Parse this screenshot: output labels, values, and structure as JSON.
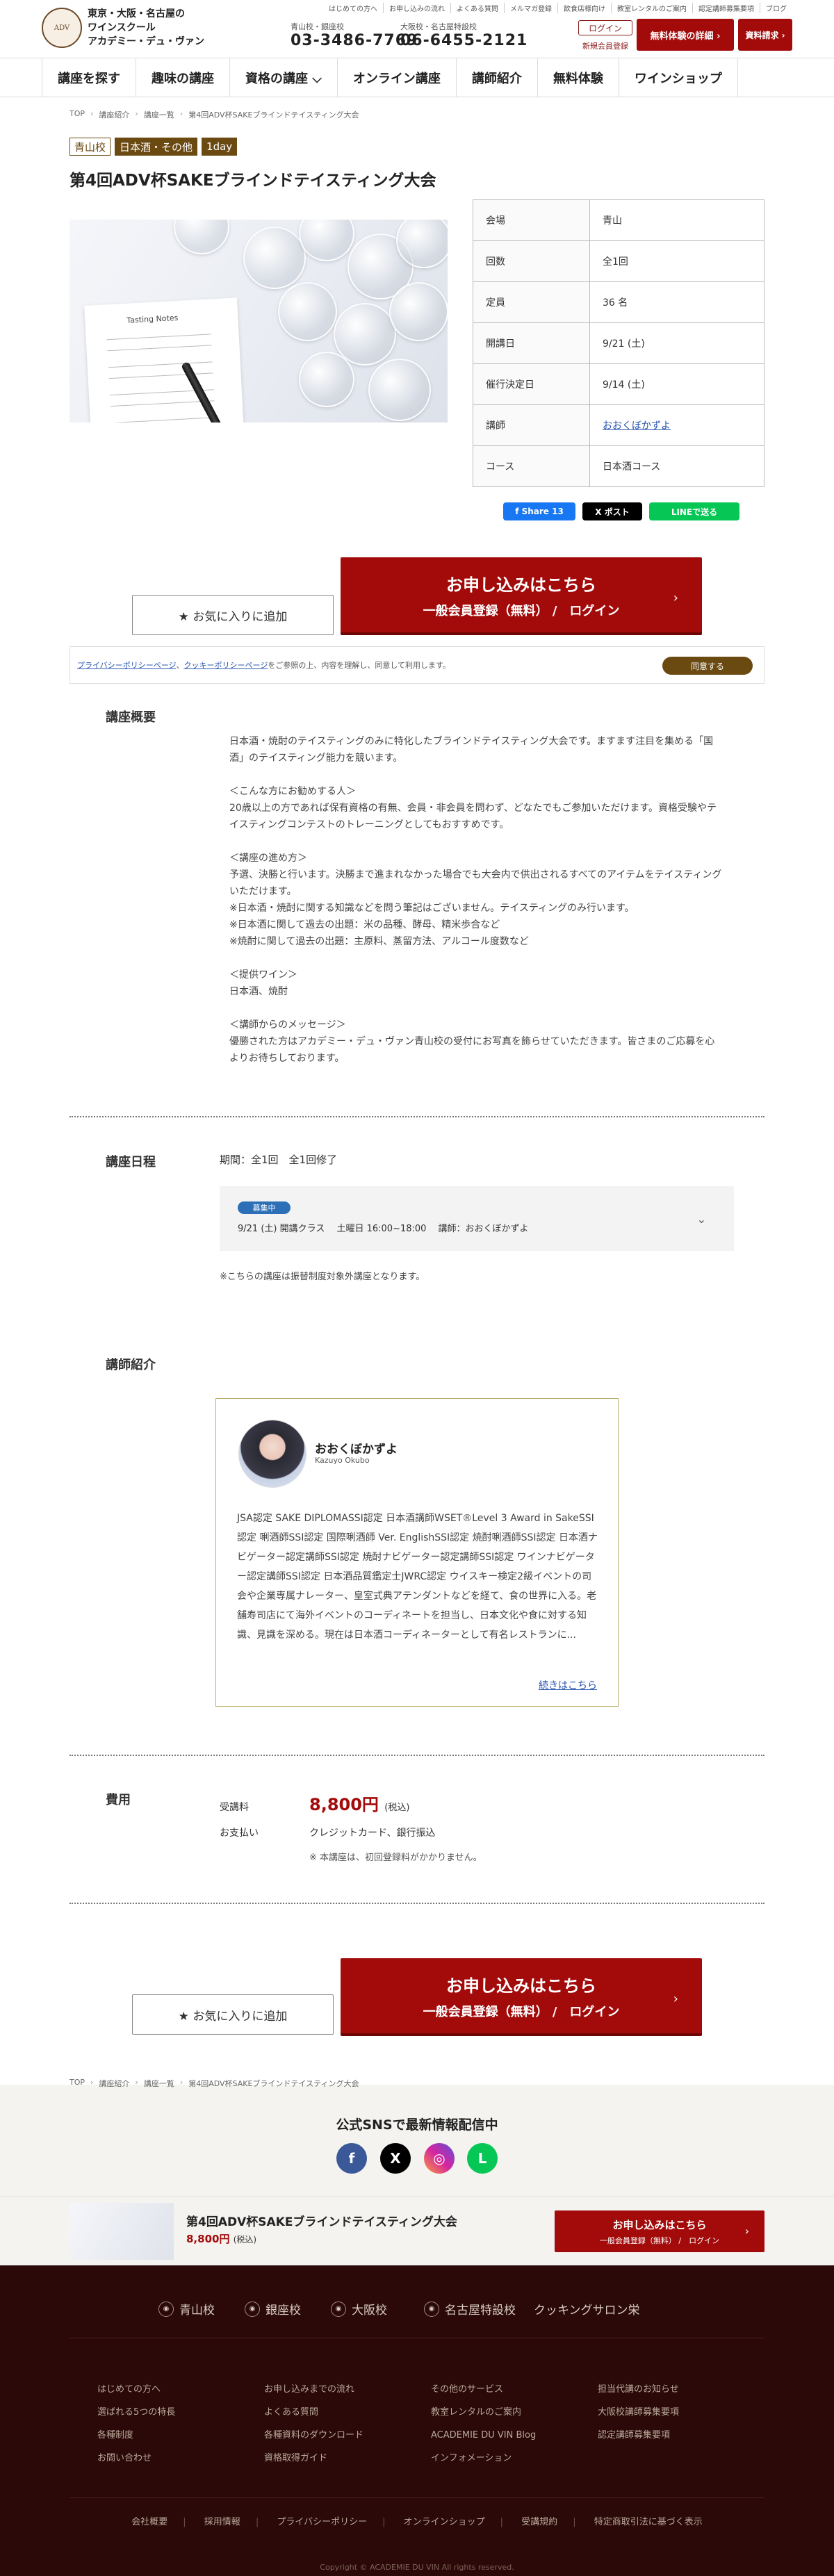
{
  "header": {
    "logo_mark": "ADV",
    "logo_lines": [
      "東京・大阪・名古屋の",
      "ワインスクール",
      "アカデミー・デュ・ヴァン"
    ],
    "util_links": [
      "はじめての方へ",
      "お申し込みの流れ",
      "よくある質問",
      "メルマガ登録",
      "飲食店様向け",
      "教室レンタルのご案内",
      "認定講師募集要項",
      "ブログ"
    ],
    "phone1_label": "青山校・銀座校",
    "phone1_num": "03-3486-7769",
    "phone2_label": "大阪校・名古屋特設校",
    "phone2_num": "06-6455-2121",
    "login": "ログイン",
    "register": "新規会員登録",
    "trial": "無料体験の詳細 ›",
    "docs": "資料請求 ›"
  },
  "nav": [
    "講座を探す",
    "趣味の講座",
    "資格の講座 ⌵",
    "オンライン講座",
    "講師紹介",
    "無料体験",
    "ワインショップ"
  ],
  "breadcrumb": [
    "TOP",
    "講座紹介",
    "講座一覧",
    "第4回ADV杯SAKEブラインドテイスティング大会"
  ],
  "tags": [
    "青山校",
    "日本酒・その他",
    "1day"
  ],
  "title": "第4回ADV杯SAKEブラインドテイスティング大会",
  "photo_text": "Tasting Notes",
  "info": [
    {
      "k": "会場",
      "v": "青山"
    },
    {
      "k": "回数",
      "v": "全1回"
    },
    {
      "k": "定員",
      "v": "36 名"
    },
    {
      "k": "開講日",
      "v": "9/21 (土)"
    },
    {
      "k": "催行決定日",
      "v": "9/14 (土)"
    },
    {
      "k": "講師",
      "v": "おおくぼかずよ"
    },
    {
      "k": "コース",
      "v": "日本酒コース"
    }
  ],
  "share": {
    "fb": "f Share 13",
    "x": "X ポスト",
    "line": "LINEで送る"
  },
  "fav_label": "★ お気に入りに追加",
  "apply": {
    "line1": "お申し込みはこちら",
    "line2": "一般会員登録（無料） /　ログイン",
    "arrow": "›"
  },
  "cookie": {
    "privacy": "プライバシーポリシーページ",
    "sep": "、",
    "cookie_policy": "クッキーポリシーページ",
    "rest": "をご参照の上、内容を理解し、同意して利用します。",
    "button": "同意する"
  },
  "overview": {
    "heading": "講座概要",
    "paragraphs": [
      "日本酒・焼酎のテイスティングのみに特化したブラインドテイスティング大会です。ますます注目を集める「国酒」のテイスティング能力を競います。",
      "＜こんな方にお勧めする人＞",
      "20歳以上の方であれば保有資格の有無、会員・非会員を問わず、どなたでもご参加いただけます。資格受験やテイスティングコンテストのトレーニングとしてもおすすめです。",
      "＜講座の進め方＞",
      "予選、決勝と行います。決勝まで進まれなかった場合でも大会内で供出されるすべてのアイテムをテイスティングいただけます。",
      "※日本酒・焼酎に関する知識などを問う筆記はございません。テイスティングのみ行います。",
      "※日本酒に関して過去の出題：米の品種、酵母、精米歩合など",
      "※焼酎に関して過去の出題：主原料、蒸留方法、アルコール度数など",
      "＜提供ワイン＞",
      "日本酒、焼酎",
      "＜講師からのメッセージ＞",
      "優勝された方はアカデミー・デュ・ヴァン青山校の受付にお写真を飾らせていただきます。皆さまのご応募を心よりお待ちしております。"
    ]
  },
  "schedule": {
    "heading": "講座日程",
    "meta": "期間：全1回　全1回修了",
    "badge": "募集中",
    "line": "9/21 (土) 開講クラス　 土曜日 16:00~18:00　 講師：おおくぼかずよ",
    "chevron": "⌄",
    "note": "※こちらの講座は振替制度対象外講座となります。"
  },
  "teacher": {
    "heading": "講師紹介",
    "name": "おおくぼかずよ",
    "name_en": "Kazuyo Okubo",
    "bio": "JSA認定 SAKE DIPLOMASSI認定 日本酒講師WSET®Level 3 Award in SakeSSI認定 唎酒師SSI認定 国際唎酒師 Ver. EnglishSSI認定 焼酎唎酒師SSI認定 日本酒ナビゲーター認定講師SSI認定 焼酎ナビゲーター認定講師SSI認定 ワインナビゲーター認定講師SSI認定 日本酒品質鑑定士JWRC認定 ウイスキー検定2級イベントの司会や企業専属ナレーター、皇室式典アテンダントなどを経て、食の世界に入る。老舗寿司店にて海外イベントのコーディネートを担当し、日本文化や食に対する知識、見識を深める。現在は日本酒コーディネーターとして有名レストランに...",
    "more": "続きはこちら"
  },
  "fee": {
    "heading": "費用",
    "label1": "受講料",
    "price": "8,800円",
    "tax": "(税込)",
    "label2": "お支払い",
    "payment": "クレジットカード、銀行振込",
    "note": "※ 本講座は、初回登録料がかかりません。"
  },
  "sns": {
    "title": "公式SNSで最新情報配信中",
    "icons": [
      "f",
      "X",
      "◎",
      "L"
    ]
  },
  "sticky": {
    "title": "第4回ADV杯SAKEブラインドテイスティング大会",
    "price": "8,800円",
    "tax": "(税込)",
    "btn1": "お申し込みはこちら",
    "btn2": "一般会員登録（無料） /　ログイン",
    "arrow": "›"
  },
  "footer": {
    "locations": [
      "青山校",
      "銀座校",
      "大阪校",
      "名古屋特設校"
    ],
    "salon": "クッキングサロン栄",
    "col1": [
      "はじめての方へ",
      "選ばれる5つの特長",
      "各種制度",
      "お問い合わせ"
    ],
    "col2": [
      "お申し込みまでの流れ",
      "よくある質問",
      "各種資料のダウンロード",
      "資格取得ガイド"
    ],
    "col3": [
      "その他のサービス",
      "教室レンタルのご案内",
      "ACADEMIE DU VIN Blog",
      "インフォメーション"
    ],
    "col4": [
      "担当代講のお知らせ",
      "大阪校講師募集要項",
      "認定講師募集要項"
    ],
    "links": [
      "会社概要",
      "採用情報",
      "プライバシーポリシー",
      "オンラインショップ",
      "受講規約",
      "特定商取引法に基づく表示"
    ],
    "copyright": "Copyright © ACADEMIE DU VIN All rights reserved."
  },
  "colors": {
    "accent": "#a30b0b",
    "brand_brown": "#6b4a12",
    "footer_bg": "#2a0908"
  }
}
